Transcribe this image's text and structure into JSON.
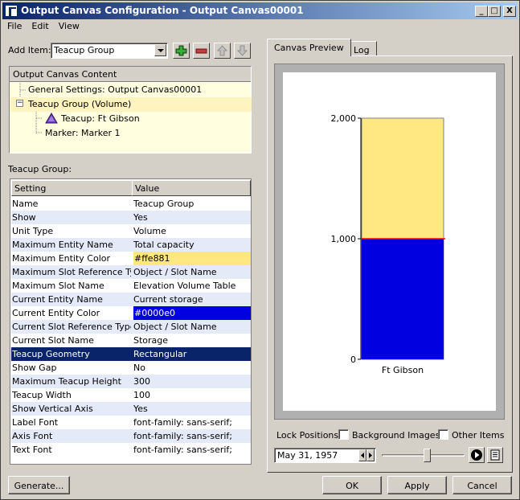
{
  "window": {
    "title": "Output Canvas Configuration - Output Canvas00001",
    "min": "_",
    "max": "□",
    "close": "X"
  },
  "menu": [
    "File",
    "Edit",
    "View"
  ],
  "add_item": {
    "label": "Add Item:",
    "value": "Teacup Group"
  },
  "tree": {
    "header": "Output Canvas Content",
    "items": [
      "General Settings: Output Canvas00001",
      "Teacup Group (Volume)",
      "Teacup: Ft Gibson",
      "Marker: Marker 1"
    ],
    "toggle": "−"
  },
  "group_label": "Teacup Group:",
  "table": {
    "headers": [
      "Setting",
      "Value"
    ],
    "rows": [
      {
        "k": "Name",
        "v": "Teacup Group"
      },
      {
        "k": "Show",
        "v": "Yes"
      },
      {
        "k": "Unit Type",
        "v": "Volume"
      },
      {
        "k": "Maximum Entity Name",
        "v": "Total capacity"
      },
      {
        "k": "Maximum Entity Color",
        "v": "#ffe881",
        "bg": "#ffe881"
      },
      {
        "k": "Maximum Slot Reference Type",
        "v": "Object / Slot Name"
      },
      {
        "k": "Maximum Slot Name",
        "v": "Elevation Volume Table"
      },
      {
        "k": "Current Entity Name",
        "v": "Current storage"
      },
      {
        "k": "Current Entity Color",
        "v": "#0000e0",
        "bg": "#0000e0",
        "fg": "#ffffff"
      },
      {
        "k": "Current Slot Reference Type",
        "v": "Object / Slot Name"
      },
      {
        "k": "Current Slot Name",
        "v": "Storage"
      },
      {
        "k": "Teacup Geometry",
        "v": "Rectangular",
        "selected": true
      },
      {
        "k": "Show Gap",
        "v": "No"
      },
      {
        "k": "Maximum Teacup Height",
        "v": "300"
      },
      {
        "k": "Teacup Width",
        "v": "100"
      },
      {
        "k": "Show Vertical Axis",
        "v": "Yes"
      },
      {
        "k": "Label Font",
        "v": "font-family: sans-serif;"
      },
      {
        "k": "Axis Font",
        "v": "font-family: sans-serif;"
      },
      {
        "k": "Text Font",
        "v": "font-family: sans-serif;"
      }
    ]
  },
  "tabs": [
    "Canvas Preview",
    "Log"
  ],
  "chart_data": {
    "type": "bar",
    "categories": [
      "Ft Gibson"
    ],
    "series": [
      {
        "name": "Total capacity",
        "values": [
          2000
        ],
        "color": "#ffe881"
      },
      {
        "name": "Current storage",
        "values": [
          1000
        ],
        "color": "#0000e0"
      }
    ],
    "yticks": [
      "2,000",
      "1,000",
      "0"
    ],
    "ylim": [
      0,
      2000
    ],
    "marker_value": 1000,
    "marker_color": "#ff0000"
  },
  "lock": {
    "label": "Lock Positions:",
    "bg": "Background Images",
    "other": "Other Items"
  },
  "date": "May 31, 1957",
  "slider_pos": 0.55,
  "buttons": {
    "generate": "Generate...",
    "ok": "OK",
    "apply": "Apply",
    "cancel": "Cancel"
  }
}
